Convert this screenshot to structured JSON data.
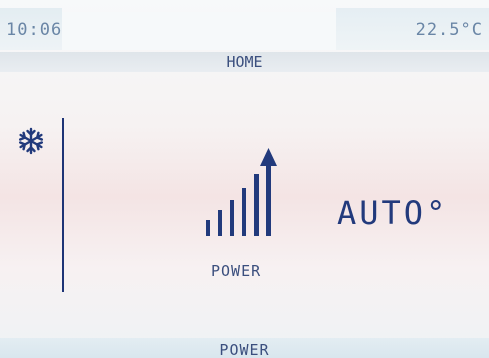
{
  "status": {
    "time": "10:06",
    "temperature": "22.5°C"
  },
  "header": {
    "title": "HOME"
  },
  "main": {
    "mode_icon": "snowflake-icon",
    "power_icon": "signal-bars-arrow-icon",
    "power_label": "POWER",
    "mode_value": "AUTO°"
  },
  "footer": {
    "label": "POWER"
  },
  "colors": {
    "accent": "#223a7c",
    "text_light": "#6a86a6"
  }
}
